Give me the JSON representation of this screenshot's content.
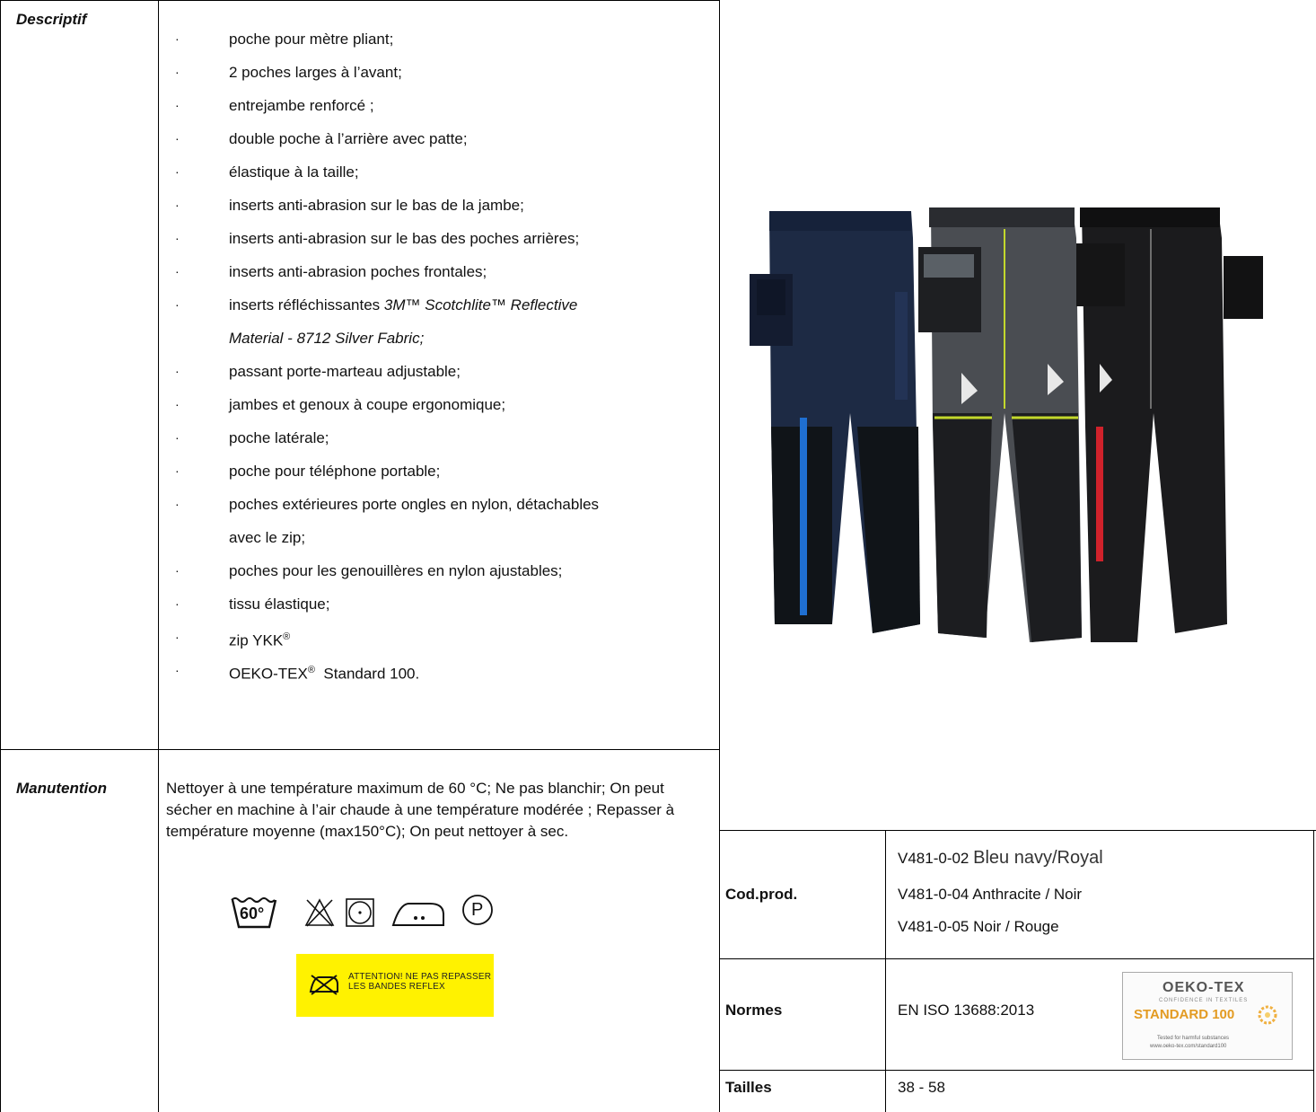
{
  "labels": {
    "descriptif": "Descriptif",
    "manutention": "Manutention",
    "codprod": "Cod.prod.",
    "normes": "Normes",
    "tailles": "Tailles"
  },
  "features": [
    "poche pour mètre pliant;",
    "2 poches larges à l’avant;",
    "entrejambe renforcé ;",
    "double poche à l’arrière avec patte;",
    "élastique à la taille;",
    "inserts anti-abrasion sur le bas de la jambe;",
    "inserts anti-abrasion sur le bas des poches arrières;",
    "inserts anti-abrasion poches frontales;",
    "inserts réfléchissantes",
    "passant porte-marteau adjustable;",
    "jambes et genoux à coupe ergonomique;",
    "poche latérale;",
    "poche pour téléphone portable;",
    "poches extérieures porte ongles en nylon, détachables",
    "poches pour les genouillères en nylon ajustables;",
    "tissu élastique;",
    "zip YKK",
    "OEKO-TEX",
    "Standard 100."
  ],
  "features_extra": {
    "reflective_a": "3M™ Scotchlite™ Reflective",
    "reflective_b": "Material - 8712 Silver Fabric;",
    "zip_cont": "avec le zip;",
    "reg": "®"
  },
  "bullet_glyph": "·",
  "care": {
    "text": "Nettoyer à une température maximum de 60 °C; Ne pas blanchir; On peut sécher en machine à l’air chaude à une température  modérée ; Repasser à température moyenne (max150°C); On peut nettoyer à sec.",
    "wash_temp": "60°",
    "dry_clean": "P",
    "warning_line1": "ATTENTION! NE PAS REPASSER",
    "warning_line2": "LES BANDES REFLEX"
  },
  "codprod": [
    {
      "code": "V481-0-02",
      "color": "Bleu navy/Royal"
    },
    {
      "code": "V481-0-04",
      "color": "Anthracite / Noir"
    },
    {
      "code": "V481-0-05",
      "color": "Noir / Rouge"
    }
  ],
  "normes": {
    "value": "EN ISO 13688:2013",
    "logo_line1": "OEKO-TEX",
    "logo_line2": "CONFIDENCE IN TEXTILES",
    "logo_line3": "STANDARD 100",
    "logo_line4": "Tested for harmful substances",
    "logo_line5": "www.oeko-tex.com/standard100"
  },
  "tailles": {
    "value": "38 - 58"
  },
  "colors": {
    "warning_bg": "#fff200",
    "navy": "#1d2a44",
    "anthracite": "#4a4d52",
    "black": "#1b1b1d",
    "royal": "#1f6fd1",
    "lime": "#c3d82c",
    "red": "#d0222b"
  }
}
